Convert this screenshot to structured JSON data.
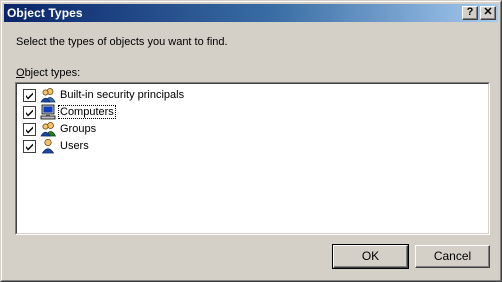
{
  "window": {
    "title": "Object Types",
    "help_glyph": "?",
    "close_glyph": "✕"
  },
  "instruction": "Select the types of objects you want to find.",
  "list_label": {
    "accel": "O",
    "rest": "bject types:"
  },
  "object_types": [
    {
      "label": "Built-in security principals",
      "checked": true,
      "icon": "security-principals-icon"
    },
    {
      "label": "Computers",
      "checked": true,
      "icon": "computer-icon",
      "focused": true
    },
    {
      "label": "Groups",
      "checked": true,
      "icon": "group-icon"
    },
    {
      "label": "Users",
      "checked": true,
      "icon": "user-icon"
    }
  ],
  "buttons": {
    "ok": "OK",
    "cancel": "Cancel"
  }
}
